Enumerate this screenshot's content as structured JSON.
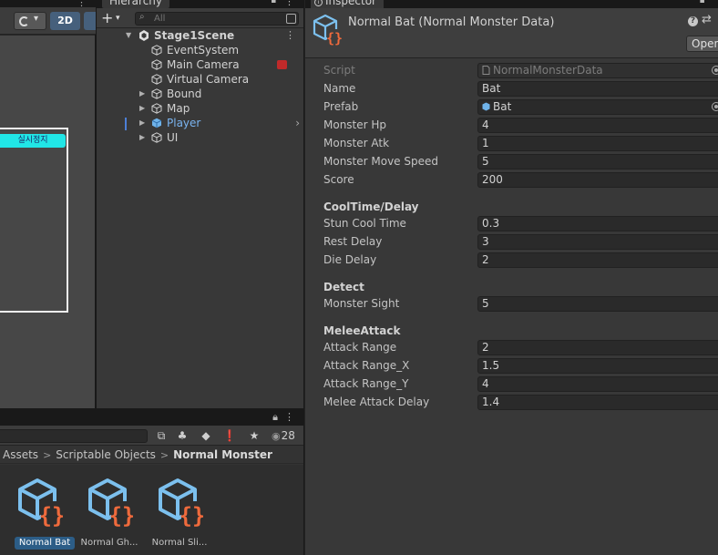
{
  "scene": {
    "toolbar": {
      "mode_2d_label": "2D"
    },
    "overlay_label": "실시정지"
  },
  "hierarchy": {
    "title": "Hierarchy",
    "add_label": "+",
    "search_placeholder": "All",
    "scene_name": "Stage1Scene",
    "items": [
      {
        "label": "EventSystem"
      },
      {
        "label": "Main Camera"
      },
      {
        "label": "Virtual Camera"
      },
      {
        "label": "Bound"
      },
      {
        "label": "Map"
      },
      {
        "label": "Player"
      },
      {
        "label": "UI"
      }
    ]
  },
  "project": {
    "hidden_count": "28",
    "breadcrumb": [
      "Assets",
      "Scriptable Objects",
      "Normal Monster"
    ],
    "assets": [
      {
        "label": "Normal Bat",
        "selected": true
      },
      {
        "label": "Normal Gh..."
      },
      {
        "label": "Normal Sli..."
      }
    ]
  },
  "inspector": {
    "tab_title": "Inspector",
    "object_title": "Normal Bat (Normal Monster Data)",
    "open_label": "Open",
    "script_label": "Script",
    "script_value": "NormalMonsterData",
    "name_label": "Name",
    "name_value": "Bat",
    "prefab_label": "Prefab",
    "prefab_value": "Bat",
    "general": [
      {
        "label": "Monster Hp",
        "value": "4"
      },
      {
        "label": "Monster Atk",
        "value": "1"
      },
      {
        "label": "Monster Move Speed",
        "value": "5"
      },
      {
        "label": "Score",
        "value": "200"
      }
    ],
    "cooltime": {
      "header": "CoolTime/Delay",
      "rows": [
        {
          "label": "Stun Cool Time",
          "value": "0.3"
        },
        {
          "label": "Rest Delay",
          "value": "3"
        },
        {
          "label": "Die Delay",
          "value": "2"
        }
      ]
    },
    "detect": {
      "header": "Detect",
      "rows": [
        {
          "label": "Monster Sight",
          "value": "5"
        }
      ]
    },
    "melee": {
      "header": "MeleeAttack",
      "rows": [
        {
          "label": "Attack Range",
          "value": "2"
        },
        {
          "label": "Attack Range_X",
          "value": "1.5"
        },
        {
          "label": "Attack Range_Y",
          "value": "4"
        },
        {
          "label": "Melee Attack Delay",
          "value": "1.4"
        }
      ]
    }
  },
  "colors": {
    "selection_blue": "#2c5d87",
    "player_text": "#7ab4f0",
    "so_cube_blue": "#7cc0ee",
    "so_brace_orange": "#ef6a3c",
    "overlay_cyan": "#21e6e6"
  },
  "icons": {
    "gizmo": "circle-toggle-icon",
    "scene": "unity-scene-icon",
    "gameobject": "cube-outline-icon",
    "prefab": "cube-blue-icon",
    "scriptable_object": "scriptable-object-icon",
    "lock": "lock-icon",
    "menu": "kebab-menu-icon",
    "help": "help-icon",
    "settings": "sliders-icon"
  }
}
